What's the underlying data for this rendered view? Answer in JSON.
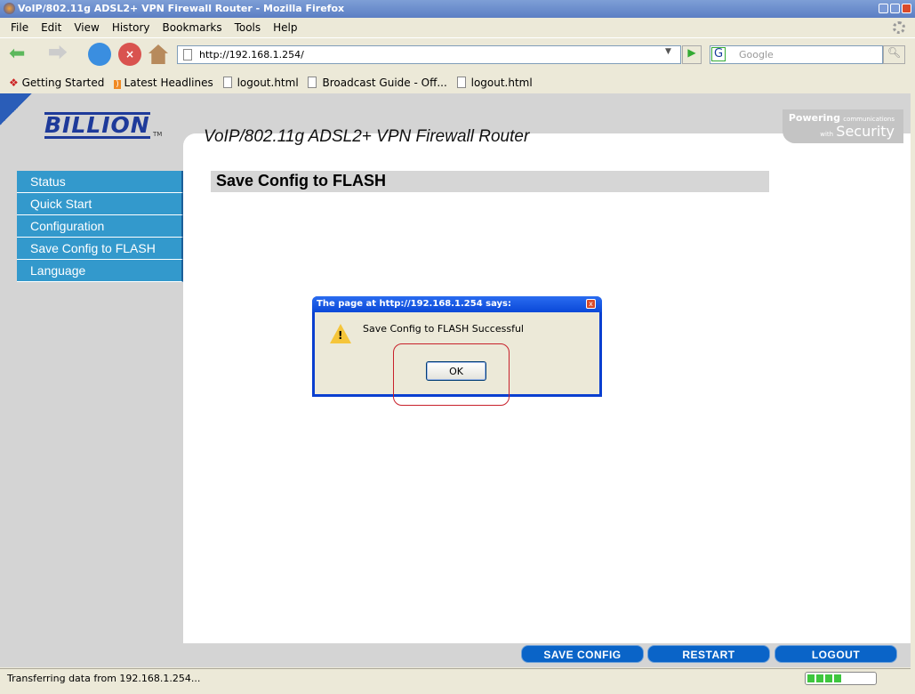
{
  "window": {
    "title": "VoIP/802.11g ADSL2+ VPN Firewall Router - Mozilla Firefox"
  },
  "menu": [
    "File",
    "Edit",
    "View",
    "History",
    "Bookmarks",
    "Tools",
    "Help"
  ],
  "toolbar": {
    "url": "http://192.168.1.254/",
    "search_placeholder": "Google",
    "search_engine": "G"
  },
  "bookmarks": [
    "Getting Started",
    "Latest Headlines",
    "logout.html",
    "Broadcast Guide - Off...",
    "logout.html"
  ],
  "page": {
    "logo": "BILLION",
    "trademark": "TM",
    "product": "VoIP/802.11g ADSL2+ VPN Firewall Router",
    "tagline_1": "Powering",
    "tagline_2": "communications",
    "tagline_3": "with",
    "tagline_4": "Security",
    "heading": "Save Config to FLASH",
    "sidebar": [
      "Status",
      "Quick Start",
      "Configuration",
      "Save Config to FLASH",
      "Language"
    ],
    "buttons": {
      "save": "SAVE CONFIG",
      "restart": "RESTART",
      "logout": "LOGOUT"
    }
  },
  "dialog": {
    "title": "The page at http://192.168.1.254 says:",
    "message": "Save Config to FLASH Successful",
    "ok": "OK"
  },
  "status": {
    "text": "Transferring data from 192.168.1.254...",
    "progress_percent": 50
  }
}
